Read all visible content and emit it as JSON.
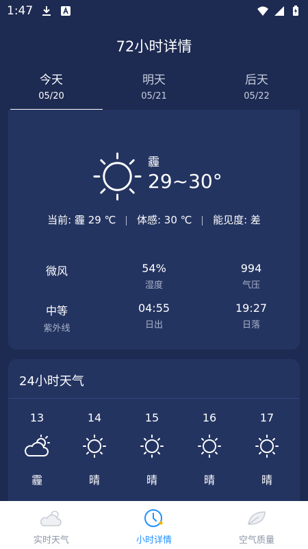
{
  "status_bar": {
    "time": "1:47"
  },
  "header": {
    "title": "72小时详情"
  },
  "day_tabs": [
    {
      "label": "今天",
      "date": "05/20",
      "active": true
    },
    {
      "label": "明天",
      "date": "05/21",
      "active": false
    },
    {
      "label": "后天",
      "date": "05/22",
      "active": false
    }
  ],
  "current": {
    "icon": "sun-icon",
    "condition": "霾",
    "temp_range": "29~30°",
    "now_text": "当前: 霾 29 ℃",
    "feels_text": "体感: 30 ℃",
    "visibility_text": "能见度: 差",
    "stats": [
      {
        "value": "微风",
        "label": ""
      },
      {
        "value": "54%",
        "label": "湿度"
      },
      {
        "value": "994",
        "label": "气压"
      },
      {
        "value": "中等",
        "label": "紫外线"
      },
      {
        "value": "04:55",
        "label": "日出"
      },
      {
        "value": "19:27",
        "label": "日落"
      }
    ]
  },
  "hourly": {
    "title": "24小时天气",
    "items": [
      {
        "hour": "13",
        "icon": "partly-cloudy-icon",
        "cond": "霾",
        "temp": ""
      },
      {
        "hour": "14",
        "icon": "sun-icon",
        "cond": "晴",
        "temp": ""
      },
      {
        "hour": "15",
        "icon": "sun-icon",
        "cond": "晴",
        "temp": ""
      },
      {
        "hour": "16",
        "icon": "sun-icon",
        "cond": "晴",
        "temp": ""
      },
      {
        "hour": "17",
        "icon": "sun-icon",
        "cond": "晴",
        "temp": ""
      }
    ]
  },
  "bottom_nav": [
    {
      "label": "实时天气",
      "icon": "cloud-sun-icon",
      "active": false
    },
    {
      "label": "小时详情",
      "icon": "clock-icon",
      "active": true
    },
    {
      "label": "空气质量",
      "icon": "leaf-icon",
      "active": false
    }
  ],
  "colors": {
    "background": "#1d2a52",
    "card": "#243461",
    "accent": "#1e90ff"
  }
}
